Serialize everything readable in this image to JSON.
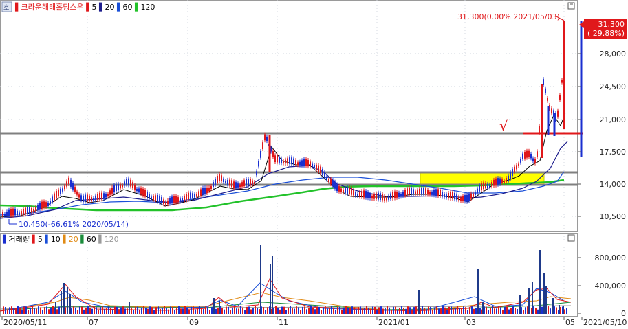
{
  "stock_name": "크라운해태홀딩스우",
  "icons": {
    "price_corner": "expand-icon",
    "volume_corner": "expand-icon",
    "legend": "menu-icon"
  },
  "price_panel": {
    "legend": {
      "ma_labels": [
        {
          "label": "5",
          "color": "#e0181b"
        },
        {
          "label": "20",
          "color": "#1c1c8c"
        },
        {
          "label": "60",
          "color": "#1a4fd8"
        },
        {
          "label": "120",
          "color": "#22c22a"
        }
      ]
    },
    "high_annotation": "31,300(0.00% 2021/05/03)",
    "low_annotation": "10,450(-66.61% 2020/05/14)",
    "price_box_line1": "31,300",
    "price_box_line2": "( 29.88%)",
    "check_mark": "√",
    "y_ticks": [
      "28,000",
      "24,500",
      "21,000",
      "17,500",
      "14,000",
      "10,500"
    ]
  },
  "volume_panel": {
    "title": "거래량",
    "ma_labels": [
      {
        "label": "5",
        "color": "#e0181b"
      },
      {
        "label": "10",
        "color": "#1a4fd8"
      },
      {
        "label": "20",
        "color": "#e08a14"
      },
      {
        "label": "60",
        "color": "#1a8c3a"
      },
      {
        "label": "120",
        "color": "#9a9a9a"
      }
    ],
    "y_ticks": [
      "800,000",
      "400,000",
      "0"
    ]
  },
  "x_axis": {
    "labels": [
      "2020/05/11",
      "07",
      "09",
      "11",
      "2021/01",
      "03",
      "05",
      "2021/05/10"
    ]
  },
  "colors": {
    "up": "#e0181b",
    "down": "#1a2fd0",
    "yellow_box": "#ffff00",
    "support_line": "#808080",
    "breakout_line": "#e0181b",
    "ma5": "#000000",
    "ma20": "#1c1c8c",
    "ma120": "#22c22a"
  },
  "chart_data": [
    {
      "type": "candlestick",
      "title": "크라운해태홀딩스우",
      "y_scale": "linear",
      "ylim": [
        9000,
        33000
      ],
      "x_start": "2020/05/11",
      "x_end": "2021/05/10",
      "monthly_close_path": [
        {
          "x": "2020/05",
          "close": 10800
        },
        {
          "x": "2020/06",
          "close": 13200
        },
        {
          "x": "2020/07",
          "close": 13000
        },
        {
          "x": "2020/08",
          "close": 12900
        },
        {
          "x": "2020/09",
          "close": 13400
        },
        {
          "x": "2020/10",
          "close": 15800
        },
        {
          "x": "2020/11",
          "close": 15400
        },
        {
          "x": "2020/12",
          "close": 12400
        },
        {
          "x": "2021/01",
          "close": 12500
        },
        {
          "x": "2021/02",
          "close": 12600
        },
        {
          "x": "2021/03",
          "close": 13600
        },
        {
          "x": "2021/04",
          "close": 16000
        },
        {
          "x": "2021/05",
          "close": 31300
        }
      ],
      "annotations": [
        {
          "label": "31,300(0.00% 2021/05/03)",
          "value": 31300
        },
        {
          "label": "10,450(-66.61% 2020/05/14)",
          "value": 10450
        }
      ],
      "horizontal_lines": [
        19200,
        15200,
        13900
      ],
      "highlight_box": {
        "from": "2021/01",
        "to": "2021/04",
        "low": 13900,
        "high": 15200
      }
    },
    {
      "type": "bar",
      "title": "거래량",
      "ylim": [
        0,
        1000000
      ],
      "yticks": [
        0,
        400000,
        800000
      ],
      "spikes": [
        {
          "x": "2020/06",
          "value": 430000
        },
        {
          "x": "2020/10",
          "value": 950000
        },
        {
          "x": "2020/11",
          "value": 900000
        },
        {
          "x": "2021/01",
          "value": 320000
        },
        {
          "x": "2021/03",
          "value": 620000
        },
        {
          "x": "2021/04",
          "value": 890000
        },
        {
          "x": "2021/05",
          "value": 720000
        }
      ]
    }
  ]
}
